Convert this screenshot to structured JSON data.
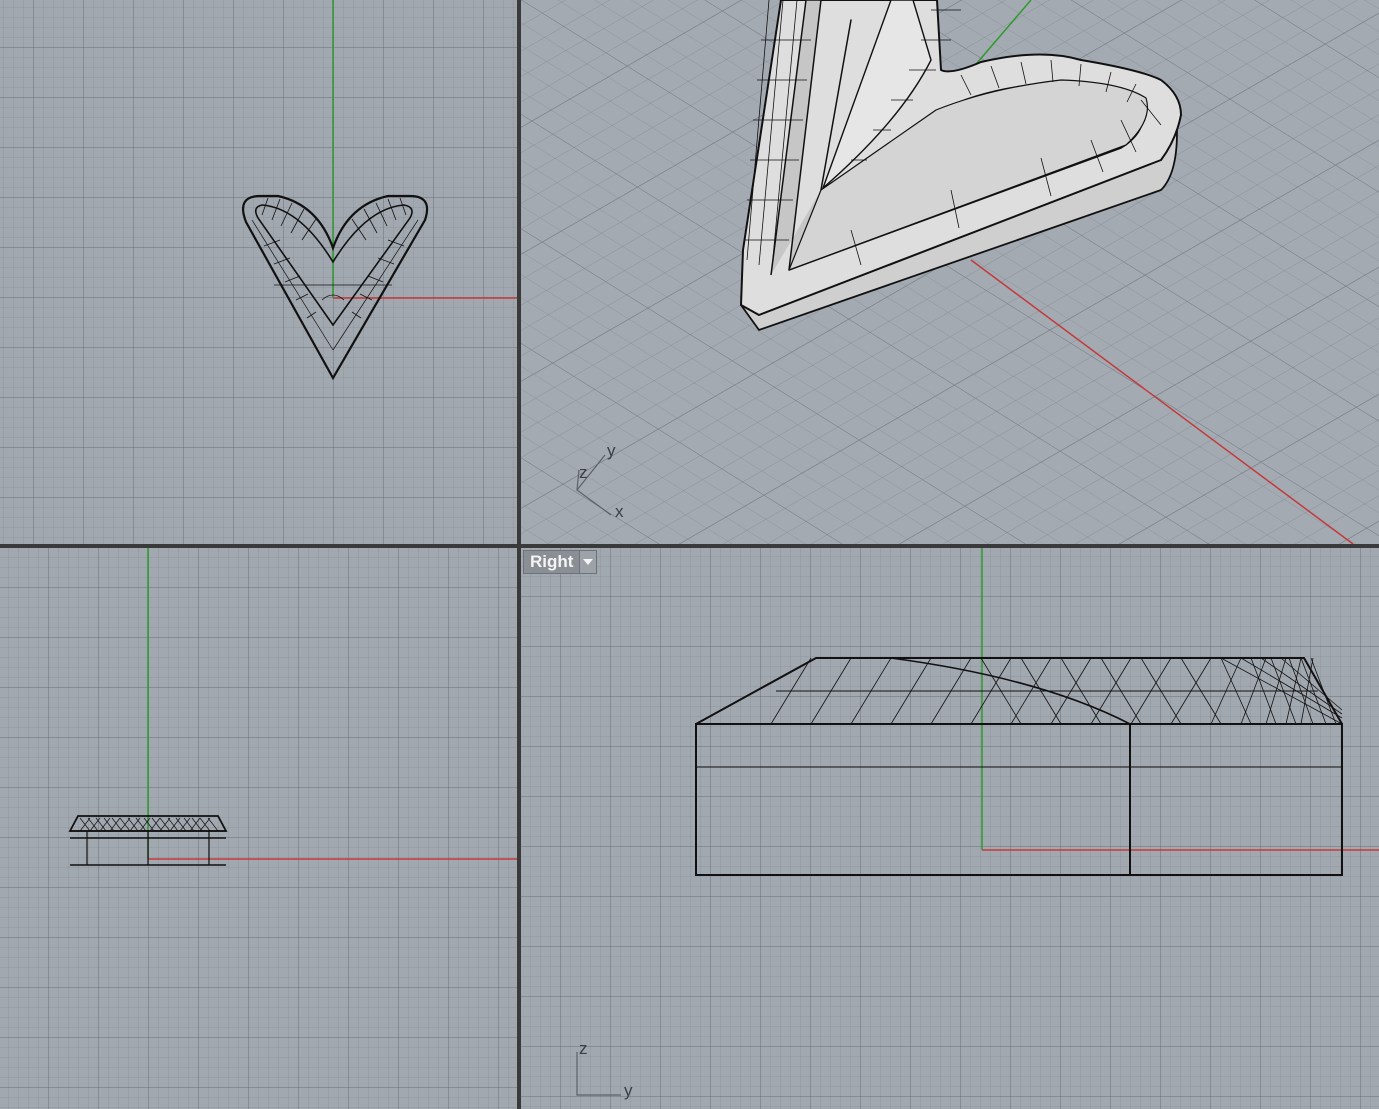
{
  "viewports": {
    "top_left": {
      "label": ""
    },
    "perspective": {
      "label": "",
      "axis_icon": {
        "z": "z",
        "y": "y",
        "x": "x"
      }
    },
    "bottom_left": {
      "label": ""
    },
    "right": {
      "label": "Right",
      "axis_icon": {
        "z": "z",
        "y": "y"
      }
    }
  },
  "colors": {
    "viewport_bg": "#a2a8b0",
    "grid_line": "#7c8290",
    "x_axis": "#c43a3a",
    "y_axis": "#2e9a2e",
    "wireframe": "#111111",
    "shaded_surface": "#dcdcdc",
    "divider": "#3a3a3a"
  },
  "icons": {
    "viewport_menu": "chevron-down-icon",
    "axis_gizmo": "axis-triad-icon"
  }
}
